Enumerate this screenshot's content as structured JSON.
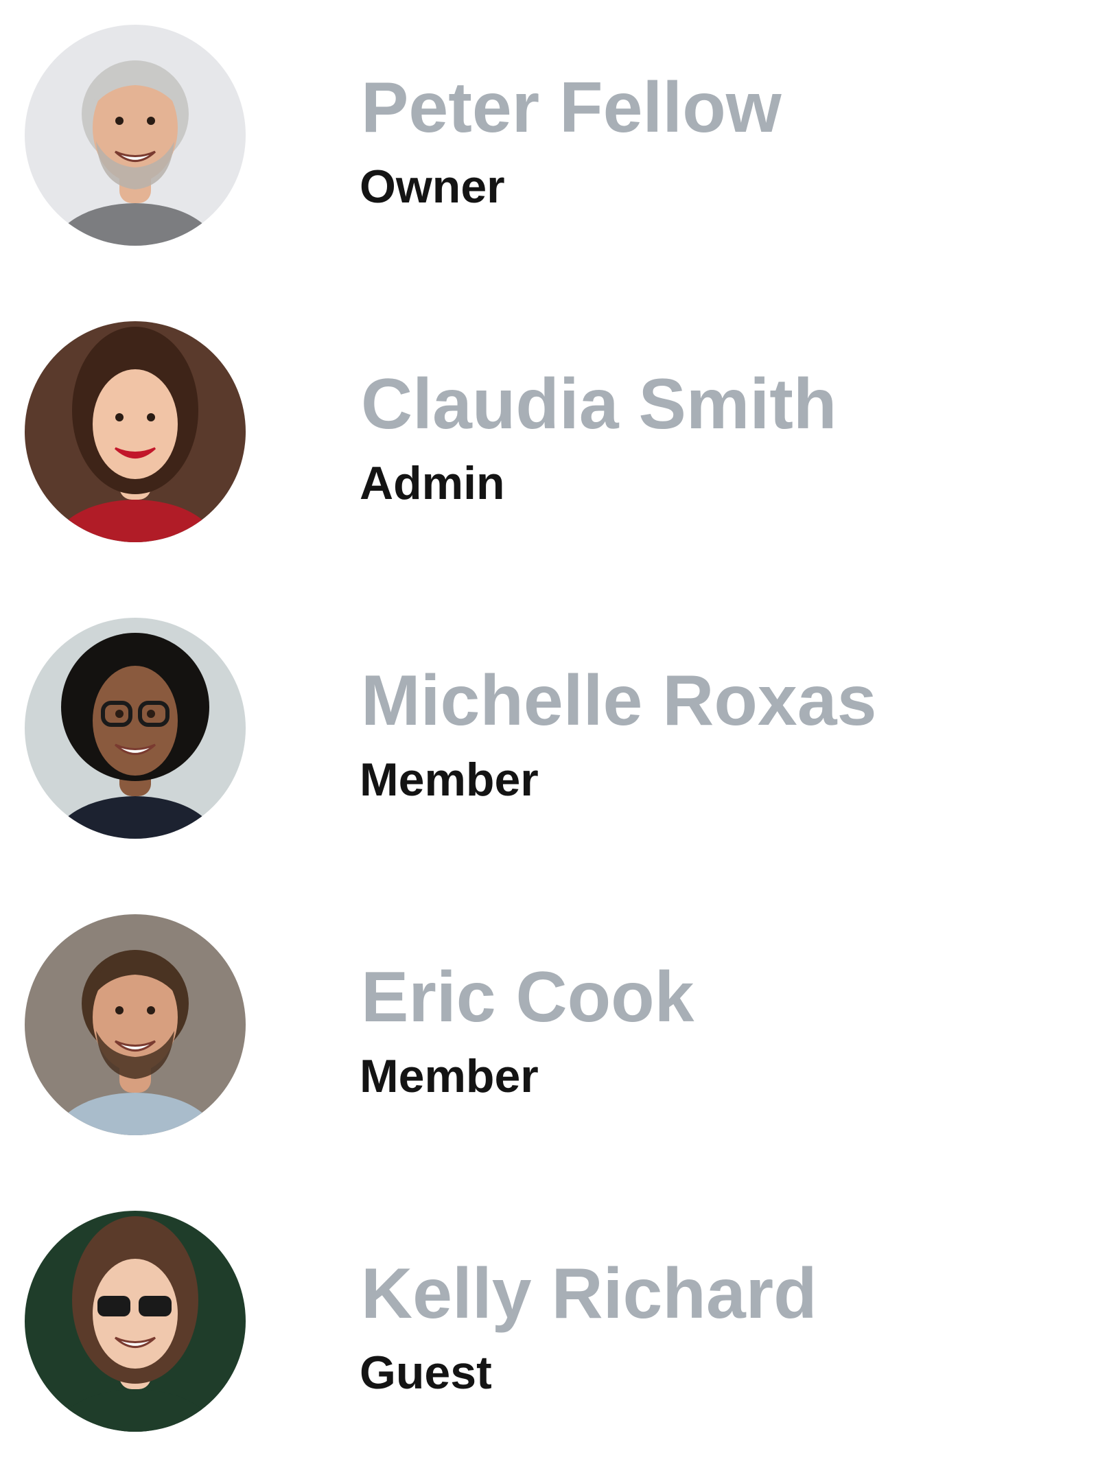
{
  "members": [
    {
      "name": "Peter Fellow",
      "role": "Owner",
      "avatar_icon": "avatar-photo-gray-haired-man",
      "colors": {
        "bg": "#e6e7ea",
        "skin": "#e4b394",
        "hair": "#c9c9c7",
        "shirt": "#7c7d80",
        "collar": "#f2f2f2"
      }
    },
    {
      "name": "Claudia Smith",
      "role": "Admin",
      "avatar_icon": "avatar-photo-smiling-woman-dark-hair",
      "colors": {
        "bg": "#5a3a2c",
        "skin": "#f1c4a6",
        "hair": "#3e2418",
        "shirt": "#b11c27",
        "collar": "#b11c27"
      }
    },
    {
      "name": "Michelle Roxas",
      "role": "Member",
      "avatar_icon": "avatar-photo-woman-curly-hair-glasses",
      "colors": {
        "bg": "#cfd6d7",
        "skin": "#8a5a3e",
        "hair": "#141210",
        "shirt": "#1c2230",
        "collar": "#1c2230"
      }
    },
    {
      "name": "Eric Cook",
      "role": "Member",
      "avatar_icon": "avatar-photo-bearded-man",
      "colors": {
        "bg": "#8c8279",
        "skin": "#d79f7f",
        "hair": "#4a3322",
        "shirt": "#a9bccb",
        "collar": "#a9bccb"
      }
    },
    {
      "name": "Kelly Richard",
      "role": "Guest",
      "avatar_icon": "avatar-photo-woman-sunglasses",
      "colors": {
        "bg": "#1f3d2a",
        "skin": "#f0c8ad",
        "hair": "#5b3b2a",
        "shirt": "#1f3d2a",
        "collar": "#1f3d2a"
      }
    }
  ]
}
